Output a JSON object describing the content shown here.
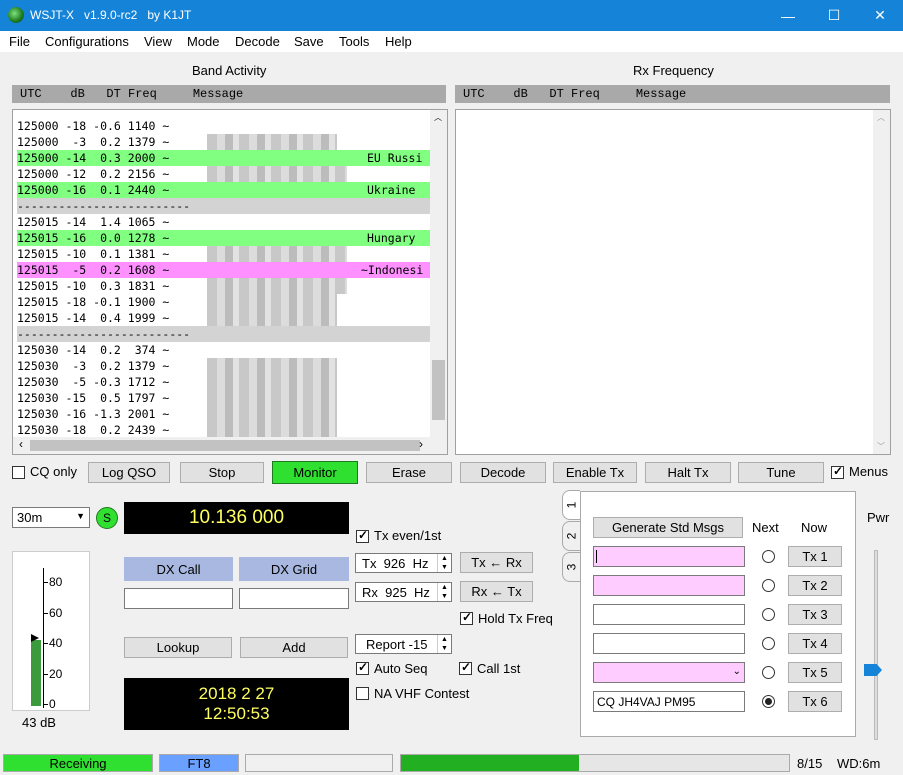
{
  "window": {
    "title": "WSJT-X   v1.9.0-rc2   by K1JT",
    "min": "—",
    "max": "☐",
    "close": "✕"
  },
  "menu": [
    "File",
    "Configurations",
    "View",
    "Mode",
    "Decode",
    "Save",
    "Tools",
    "Help"
  ],
  "band_activity": {
    "title": "Band Activity",
    "header": "UTC    dB   DT Freq     Message"
  },
  "rx_frequency": {
    "title": "Rx Frequency",
    "header": "UTC    dB   DT Freq     Message"
  },
  "decodes": [
    {
      "t": "125000",
      "db": "-18",
      "dt": "-0.6",
      "f": "1140",
      "hl": "",
      "note": ""
    },
    {
      "t": "125000",
      "db": " -3",
      "dt": " 0.2",
      "f": "1379",
      "hl": "",
      "note": ""
    },
    {
      "t": "125000",
      "db": "-14",
      "dt": " 0.3",
      "f": "2000",
      "hl": "#80ff80",
      "note": "EU Russi"
    },
    {
      "t": "125000",
      "db": "-12",
      "dt": " 0.2",
      "f": "2156",
      "hl": "",
      "note": ""
    },
    {
      "t": "125000",
      "db": "-16",
      "dt": " 0.1",
      "f": "2440",
      "hl": "#80ff80",
      "note": "Ukraine"
    },
    {
      "sep": true
    },
    {
      "t": "125015",
      "db": "-14",
      "dt": " 1.4",
      "f": "1065",
      "hl": "",
      "note": ""
    },
    {
      "t": "125015",
      "db": "-16",
      "dt": " 0.0",
      "f": "1278",
      "hl": "#80ff80",
      "note": "Hungary"
    },
    {
      "t": "125015",
      "db": "-10",
      "dt": " 0.1",
      "f": "1381",
      "hl": "",
      "note": ""
    },
    {
      "t": "125015",
      "db": " -5",
      "dt": " 0.2",
      "f": "1608",
      "hl": "#ff90ff",
      "note": "~Indonesi"
    },
    {
      "t": "125015",
      "db": "-10",
      "dt": " 0.3",
      "f": "1831",
      "hl": "",
      "note": ""
    },
    {
      "t": "125015",
      "db": "-18",
      "dt": "-0.1",
      "f": "1900",
      "hl": "",
      "note": ""
    },
    {
      "t": "125015",
      "db": "-14",
      "dt": " 0.4",
      "f": "1999",
      "hl": "",
      "note": ""
    },
    {
      "sep": true
    },
    {
      "t": "125030",
      "db": "-14",
      "dt": " 0.2",
      "f": " 374",
      "hl": "",
      "note": ""
    },
    {
      "t": "125030",
      "db": " -3",
      "dt": " 0.2",
      "f": "1379",
      "hl": "",
      "note": ""
    },
    {
      "t": "125030",
      "db": " -5",
      "dt": "-0.3",
      "f": "1712",
      "hl": "",
      "note": ""
    },
    {
      "t": "125030",
      "db": "-15",
      "dt": " 0.5",
      "f": "1797",
      "hl": "",
      "note": ""
    },
    {
      "t": "125030",
      "db": "-16",
      "dt": "-1.3",
      "f": "2001",
      "hl": "",
      "note": ""
    },
    {
      "t": "125030",
      "db": "-18",
      "dt": " 0.2",
      "f": "2439",
      "hl": "",
      "note": ""
    }
  ],
  "controls": {
    "cq_only": "CQ only",
    "log_qso": "Log QSO",
    "stop": "Stop",
    "monitor": "Monitor",
    "erase": "Erase",
    "decode": "Decode",
    "enable_tx": "Enable Tx",
    "halt_tx": "Halt Tx",
    "tune": "Tune",
    "menus": "Menus"
  },
  "band": "30m",
  "s_badge": "S",
  "frequency": "10.136 000",
  "dx_call_label": "DX Call",
  "dx_grid_label": "DX Grid",
  "dx_call_value": "",
  "dx_grid_value": "",
  "lookup": "Lookup",
  "add": "Add",
  "datetime": {
    "date": "2018 2 27",
    "time": "12:50:53"
  },
  "meter": {
    "ticks": [
      "80",
      "60",
      "40",
      "20",
      "0"
    ],
    "level_db": 43,
    "label": "43 dB"
  },
  "tx_even": "Tx even/1st",
  "tx_freq": "Tx  926  Hz",
  "rx_freq": "Rx  925  Hz",
  "tx_from_rx": "Tx ← Rx",
  "rx_from_tx": "Rx ← Tx",
  "hold_tx_freq": "Hold Tx Freq",
  "report": "Report -15",
  "auto_seq": "Auto Seq",
  "call_1st": "Call 1st",
  "na_vhf": "NA VHF Contest",
  "tabs": [
    "1",
    "2",
    "3"
  ],
  "gen_std": "Generate Std Msgs",
  "next_label": "Next",
  "now_label": "Now",
  "tx_msgs": [
    {
      "value": "",
      "fill": "#ffccff",
      "btn": "Tx 1"
    },
    {
      "value": "",
      "fill": "#ffccff",
      "btn": "Tx 2"
    },
    {
      "value": "",
      "fill": "#ffffff",
      "btn": "Tx 3"
    },
    {
      "value": "",
      "fill": "#ffffff",
      "btn": "Tx 4"
    },
    {
      "value": "",
      "fill": "#ffccff",
      "btn": "Tx 5"
    },
    {
      "value": "CQ JH4VAJ PM95",
      "fill": "#ffffff",
      "btn": "Tx 6"
    }
  ],
  "pwr": "Pwr",
  "status": {
    "state": "Receiving",
    "mode": "FT8",
    "progress_fraction": 0.46,
    "count": "8/15",
    "wd": "WD:6m"
  }
}
